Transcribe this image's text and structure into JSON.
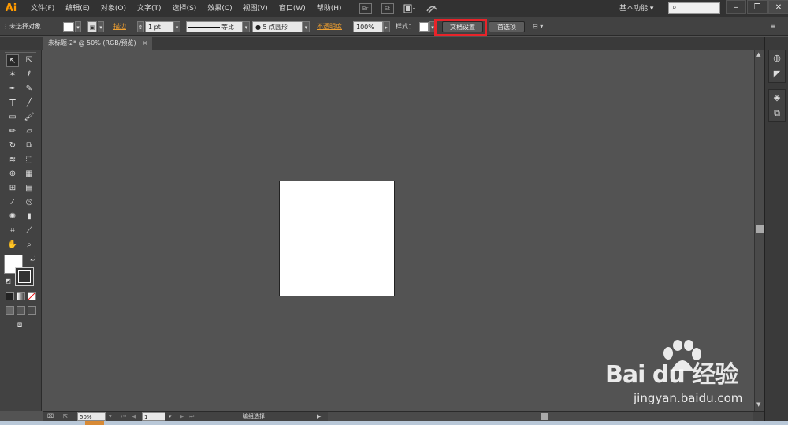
{
  "app": {
    "logo": "Ai"
  },
  "menu": [
    "文件(F)",
    "编辑(E)",
    "对象(O)",
    "文字(T)",
    "选择(S)",
    "效果(C)",
    "视图(V)",
    "窗口(W)",
    "帮助(H)"
  ],
  "menubar_icons": {
    "br": "Br",
    "st": "St"
  },
  "workspace": "基本功能",
  "window_buttons": {
    "minimize": "–",
    "restore": "❐",
    "close": "✕"
  },
  "control": {
    "selection": "未选择对象",
    "stroke_label": "描边",
    "stroke_weight": "1 pt",
    "profile": "等比",
    "brush": "● 5 点圆形",
    "opacity_label": "不透明度",
    "opacity_value": "100%",
    "style_label": "样式：",
    "doc_setup": "文档设置",
    "preferences": "首选项"
  },
  "tab": {
    "title": "未标题-2* @ 50% (RGB/预览)",
    "close": "×"
  },
  "status": {
    "zoom": "50%",
    "artboard": "1",
    "status_text": "编组选择"
  },
  "watermark": {
    "brand": "Bai du 经验",
    "url": "jingyan.baidu.com"
  },
  "colors": {
    "accent_orange": "#ff9a00",
    "highlight_red": "#e8242a",
    "artboard": "#ffffff",
    "canvas": "#535353"
  }
}
